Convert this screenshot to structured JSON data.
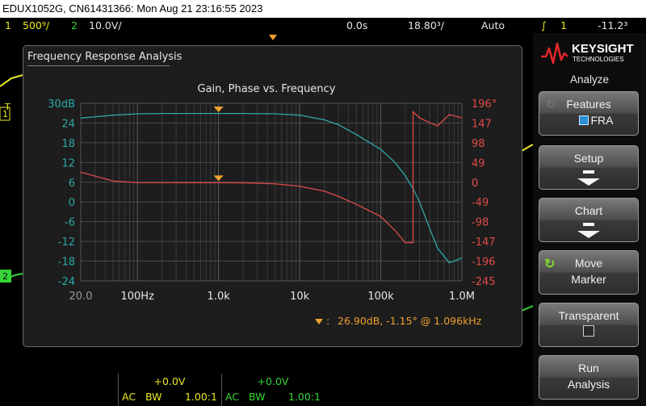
{
  "window": {
    "title": "EDUX1052G, CN61431366: Mon Aug 21 23:16:55 2023"
  },
  "status": {
    "ch1_num": "1",
    "ch1_scale": "500⁹/",
    "ch2_num": "2",
    "ch2_scale": "10.0V/",
    "time_delay": "0.0s",
    "time_scale": "18.80³/",
    "trigger_mode": "Auto",
    "trigger_ch": "1",
    "trigger_level": "-11.2³",
    "trigger_marker": "Ғ"
  },
  "markers": {
    "ch1": "1",
    "ch2": "2",
    "trigger": "T"
  },
  "dialog": {
    "title": "Frequency Response Analysis"
  },
  "chart_data": {
    "type": "line",
    "title": "Gain, Phase vs. Frequency",
    "x": [
      20,
      50,
      100,
      200,
      500,
      1000,
      2000,
      5000,
      10000,
      20000,
      30000,
      50000,
      100000,
      150000,
      200000,
      250000,
      300000,
      400000,
      500000,
      700000,
      1000000
    ],
    "xscale": "log",
    "xlim": [
      20,
      1000000
    ],
    "x_tick_labels": [
      "20.0",
      "100Hz",
      "1.0k",
      "10k",
      "100k",
      "1.0M"
    ],
    "x_tick_values": [
      20,
      100,
      1000,
      10000,
      100000,
      1000000
    ],
    "y_left": {
      "range": [
        -24,
        30
      ],
      "tick_labels": [
        "30dB",
        "24",
        "18",
        "12",
        "6",
        "0",
        "-6",
        "-12",
        "-18",
        "-24"
      ],
      "tick_values": [
        30,
        24,
        18,
        12,
        6,
        0,
        -6,
        -12,
        -18,
        -24
      ],
      "color": "#2ea7a7"
    },
    "y_right": {
      "range": [
        -245,
        196
      ],
      "tick_labels": [
        "196°",
        "147",
        "98",
        "49",
        "0",
        "-49",
        "-98",
        "-147",
        "-196",
        "-245"
      ],
      "tick_values": [
        196,
        147,
        98,
        49,
        0,
        -49,
        -98,
        -147,
        -196,
        -245
      ],
      "color": "#e04a4a"
    },
    "series": [
      {
        "axis": "left",
        "color": "#2ea7a7",
        "values": [
          25.5,
          26.4,
          26.8,
          26.9,
          26.9,
          26.9,
          26.9,
          26.8,
          26.4,
          25.0,
          23.5,
          20.5,
          16.0,
          12.0,
          8.0,
          4.0,
          0.0,
          -8.0,
          -14.0,
          -18.5,
          -17.0
        ]
      },
      {
        "axis": "right",
        "color": "#e04a4a",
        "values": [
          25.0,
          3.0,
          -1.0,
          -1.0,
          -1.1,
          -1.15,
          -1.5,
          -4.0,
          -10.0,
          -22.0,
          -35.0,
          -55.0,
          -85.0,
          -120.0,
          -150.0,
          175.0,
          160.0,
          148.0,
          140.0,
          168.0,
          160.0
        ]
      }
    ],
    "cursor": {
      "x": 1000,
      "readout": "26.90dB, -1.15° @ 1.096kHz"
    },
    "grid": true
  },
  "channels": [
    {
      "offset": "+0.0V",
      "coupling": "AC",
      "bw": "BW",
      "probe": "1.00:1",
      "color": "#e8e821"
    },
    {
      "offset": "+0.0V",
      "coupling": "AC",
      "bw": "BW",
      "probe": "1.00:1",
      "color": "#36d436"
    }
  ],
  "side": {
    "brand": "KEYSIGHT",
    "brand_sub": "TECHNOLOGIES",
    "section": "Analyze",
    "buttons": [
      {
        "line1": "Features",
        "line2": "FRA"
      },
      {
        "line1": "Setup"
      },
      {
        "line1": "Chart"
      },
      {
        "line1": "Move",
        "line2": "Marker"
      },
      {
        "line1": "Transparent"
      },
      {
        "line1": "Run",
        "line2": "Analysis"
      }
    ]
  }
}
